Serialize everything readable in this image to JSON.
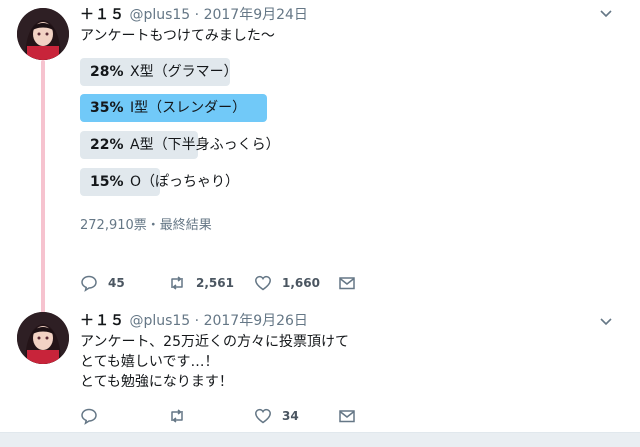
{
  "tweets": [
    {
      "display_name": "＋１５",
      "handle": "@plus15",
      "separator": "·",
      "date": "2017年9月24日",
      "text_lines": [
        "アンケートもつけてみました～"
      ],
      "poll": {
        "options": [
          {
            "percent_label": "28%",
            "choice": "X型（グラマー）",
            "percent": 28
          },
          {
            "percent_label": "35%",
            "choice": "I型（スレンダー）",
            "percent": 35
          },
          {
            "percent_label": "22%",
            "choice": "A型（下半身ふっくら）",
            "percent": 22
          },
          {
            "percent_label": "15%",
            "choice": "O（ぽっちゃり）",
            "percent": 15
          }
        ],
        "votes_text": "272,910票・最終結果"
      },
      "actions": {
        "reply_count": "45",
        "retweet_count": "2,561",
        "like_count": "1,660"
      }
    },
    {
      "display_name": "＋１５",
      "handle": "@plus15",
      "separator": "·",
      "date": "2017年9月26日",
      "text_lines": [
        "アンケート、25万近くの方々に投票頂けて",
        "とても嬉しいです…！",
        "とても勉強になります！"
      ],
      "actions": {
        "reply_count": "",
        "retweet_count": "",
        "like_count": "34"
      }
    }
  ],
  "icons": {
    "reply": "speech-bubble-icon",
    "retweet": "retweet-arrows-icon",
    "like": "heart-icon",
    "dm": "envelope-icon",
    "menu": "chevron-down-icon"
  },
  "colors": {
    "poll_winner": "#71c9f8",
    "poll_bar": "#e1e8ed",
    "thread_line": "#f6c3cf",
    "muted_text": "#657786"
  }
}
